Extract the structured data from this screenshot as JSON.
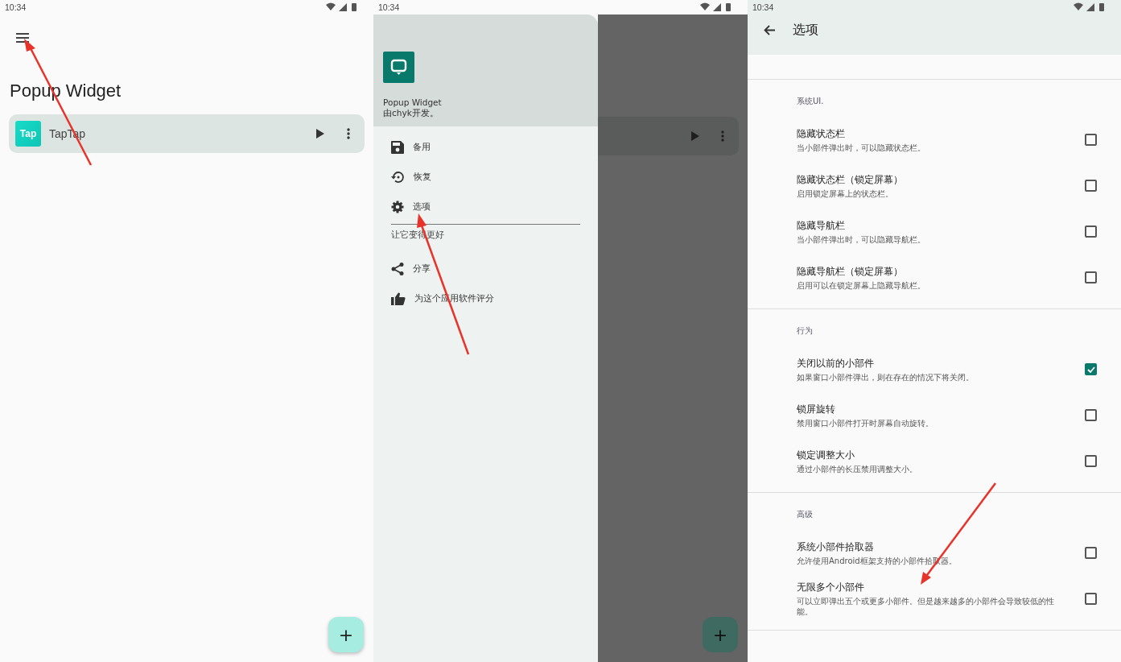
{
  "home_screen": {
    "status_time": "10:34",
    "title": "Popup Widget",
    "widgets": [
      {
        "name": "TapTap",
        "icon_text": "Tap"
      }
    ],
    "fab_label": "+"
  },
  "drawer_screen": {
    "status_time": "10:34",
    "app_name": "Popup Widget",
    "developer": "由chyk开发。",
    "menu_items": [
      {
        "kind": "save",
        "label": "备用"
      },
      {
        "kind": "restore",
        "label": "恢复"
      },
      {
        "kind": "settings",
        "label": "选项"
      }
    ],
    "section_label": "让它变得更好",
    "extra_items": [
      {
        "kind": "share",
        "label": "分享"
      },
      {
        "kind": "rate",
        "label": "为这个应用软件评分"
      }
    ],
    "fab_label": "+"
  },
  "options_screen": {
    "status_time": "10:34",
    "title": "选项",
    "sections": [
      {
        "label": "系统UI.",
        "items": [
          {
            "title": "隐藏状态栏",
            "subtitle": "当小部件弹出时，可以隐藏状态栏。",
            "checked": false
          },
          {
            "title": "隐藏状态栏（锁定屏幕）",
            "subtitle": "启用锁定屏幕上的状态栏。",
            "checked": false
          },
          {
            "title": "隐藏导航栏",
            "subtitle": "当小部件弹出时，可以隐藏导航栏。",
            "checked": false
          },
          {
            "title": "隐藏导航栏（锁定屏幕）",
            "subtitle": "启用可以在锁定屏幕上隐藏导航栏。",
            "checked": false
          }
        ]
      },
      {
        "label": "行为",
        "items": [
          {
            "title": "关闭以前的小部件",
            "subtitle": "如果窗口小部件弹出，则在存在的情况下将关闭。",
            "checked": true
          },
          {
            "title": "锁屏旋转",
            "subtitle": "禁用窗口小部件打开时屏幕自动旋转。",
            "checked": false
          },
          {
            "title": "锁定调整大小",
            "subtitle": "通过小部件的长压禁用调整大小。",
            "checked": false
          }
        ]
      },
      {
        "label": "高级",
        "items": [
          {
            "title": "系统小部件拾取器",
            "subtitle": "允许使用Android框架支持的小部件拾取器。",
            "checked": false
          },
          {
            "title": "无限多个小部件",
            "subtitle": "可以立即弹出五个或更多小部件。但是越来越多的小部件会导致较低的性能。",
            "checked": false
          }
        ]
      }
    ]
  }
}
